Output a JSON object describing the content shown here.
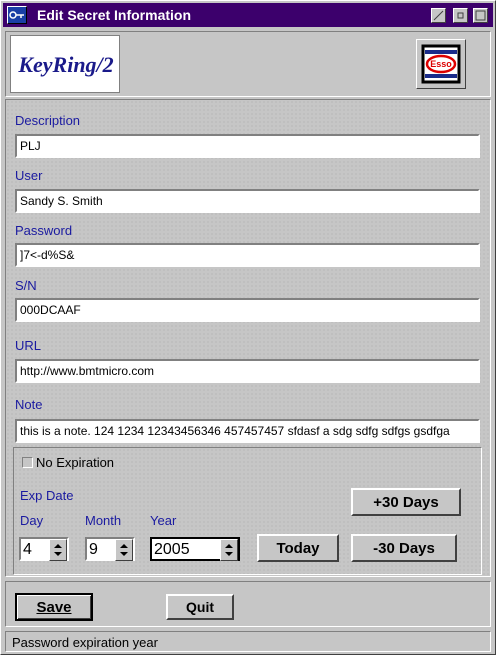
{
  "window": {
    "title": "Edit Secret Information"
  },
  "header": {
    "logo_text": "KeyRing/2",
    "badge_text": "Esso"
  },
  "fields": {
    "description": {
      "label": "Description",
      "value": "PLJ"
    },
    "user": {
      "label": "User",
      "value": "Sandy S. Smith"
    },
    "password": {
      "label": "Password",
      "value": "]7<-d%S&"
    },
    "sn": {
      "label": "S/N",
      "value": "000DCAAF"
    },
    "url": {
      "label": "URL",
      "value": "http://www.bmtmicro.com"
    },
    "note": {
      "label": "Note",
      "value": "this is a note. 124 1234 12343456346 457457457 sfdasf a sdg sdfg sdfgs gsdfga"
    }
  },
  "expiration": {
    "no_expiration_label": "No Expiration",
    "no_expiration_checked": false,
    "exp_date_label": "Exp Date",
    "day_label": "Day",
    "day_value": "4",
    "month_label": "Month",
    "month_value": "9",
    "year_label": "Year",
    "year_value": "2005",
    "plus30_label": "+30 Days",
    "today_label": "Today",
    "minus30_label": "-30 Days"
  },
  "actions": {
    "save_label": "Save",
    "quit_label": "Quit"
  },
  "status_bar": {
    "text": "Password expiration year"
  }
}
